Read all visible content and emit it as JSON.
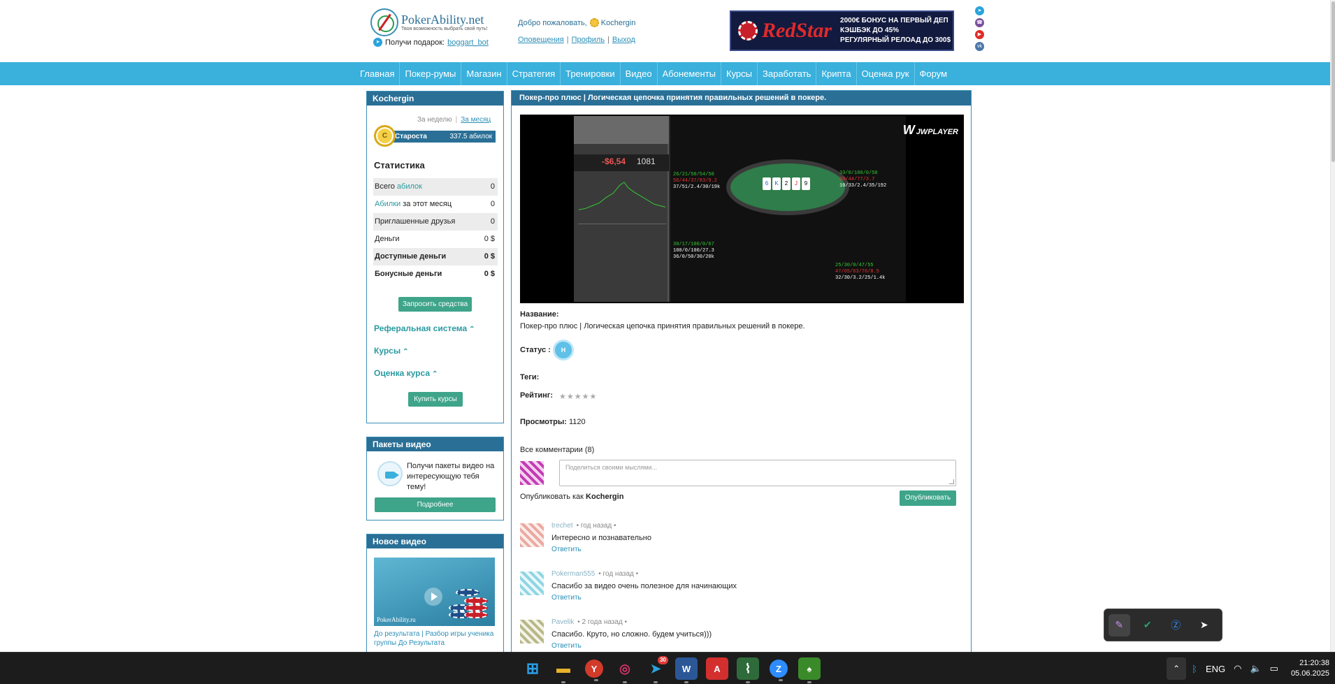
{
  "header": {
    "logo": {
      "name": "PokerAbility.net",
      "tagline": "Твоя возможность выбрать свой путь!"
    },
    "gift": {
      "label": "Получи подарок:",
      "link": "boggart_bot"
    },
    "welcome": {
      "text": "Добро пожаловать,",
      "username": "Kochergin"
    },
    "user_links": [
      "Оповещения",
      "Профиль",
      "Выход"
    ],
    "banner": {
      "brand": "RedStar",
      "lines": [
        "2000€ БОНУС НА ПЕРВЫЙ ДЕП",
        "КЭШБЭК ДО 45%",
        "РЕГУЛЯРНЫЙ РЕЛОАД ДО 300$"
      ]
    },
    "socials": [
      {
        "icon": "telegram-icon",
        "color": "#2aa3dc"
      },
      {
        "icon": "viber-icon",
        "color": "#7b519d"
      },
      {
        "icon": "youtube-icon",
        "color": "#e02a2a"
      },
      {
        "icon": "vk-icon",
        "color": "#4a76a8"
      }
    ]
  },
  "nav": [
    "Главная",
    "Покер-румы",
    "Магазин",
    "Стратегия",
    "Тренировки",
    "Видео",
    "Абонементы",
    "Курсы",
    "Заработать",
    "Крипта",
    "Оценка рук",
    "Форум"
  ],
  "sidebar": {
    "user_box": {
      "title": "Kochergin",
      "period": {
        "week": "За неделю",
        "month": "За месяц"
      },
      "rank": {
        "coin": "С",
        "label": "Староста",
        "value": "337.5 абилок"
      },
      "stats_title": "Статистика",
      "stats": [
        {
          "pre": "Всего ",
          "hl": "абилок",
          "post": "",
          "value": "0"
        },
        {
          "pre": "",
          "hl": "Абилки",
          "post": " за этот месяц",
          "value": "0"
        },
        {
          "pre": "Приглашенные друзья",
          "hl": "",
          "post": "",
          "value": "0"
        },
        {
          "pre": "Деньги",
          "hl": "",
          "post": "",
          "value": "0 $"
        },
        {
          "pre": "Доступные деньги",
          "hl": "",
          "post": "",
          "value": "0 $"
        },
        {
          "pre": "Бонусные деньги",
          "hl": "",
          "post": "",
          "value": "0 $"
        }
      ],
      "request_button": "Запросить средства",
      "sections": [
        "Реферальная система",
        "Курсы",
        "Оценка курса"
      ],
      "buy_button": "Купить курсы"
    },
    "packages_box": {
      "title": "Пакеты видео",
      "text": "Получи пакеты видео на интересующую тебя тему!",
      "button": "Подробнее"
    },
    "new_video_box": {
      "title": "Новое видео",
      "watermark": "PokerAbility.ru",
      "caption_a": "До результата",
      "caption_b": "Разбор игры ученика группы До Результата"
    }
  },
  "main": {
    "title": "Покер-про плюс | Логическая цепочка принятия правильных решений в покере.",
    "player": {
      "brand": "JWPLAYER",
      "stats": {
        "loss": "-$6,54",
        "hands": "1081"
      },
      "cards": [
        "6",
        "K",
        "2",
        "J",
        "9"
      ]
    },
    "name_label": "Название:",
    "name_value": "Покер-про плюс |  Логическая цепочка принятия правильных решений в покере.",
    "status_label": "Статус :",
    "status_badge": "Н",
    "tags_label": "Теги:",
    "rating_label": "Рейтинг:",
    "rating_stars": "★★★★★",
    "views_label": "Просмотры:",
    "views_value": "1120",
    "comments_title": "Все комментарии (8)",
    "comment_placeholder": "Поделиться своими мыслями...",
    "publish_as": "Опубликовать как",
    "publish_user": "Kochergin",
    "publish_button": "Опубликовать",
    "comments": [
      {
        "author": "trechet",
        "time": "• год назад •",
        "text": "Интересно и познавательно",
        "reply": "Ответить"
      },
      {
        "author": "Pokerman555",
        "time": "• год назад •",
        "text": "Спасибо за видео очень полезное для начинающих",
        "reply": "Ответить"
      },
      {
        "author": "Pavelik",
        "time": "• 2 года назад •",
        "text": "Спасибо. Круто, но сложно. будем учиться)))",
        "reply": "Ответить"
      }
    ]
  },
  "floating_toolbar": [
    {
      "icon": "feather-icon",
      "color": "#c48de8"
    },
    {
      "icon": "shield-check-icon",
      "color": "#2aa36a"
    },
    {
      "icon": "zoom-icon",
      "color": "#2d8cff"
    },
    {
      "icon": "send-icon",
      "color": "#ffffff"
    }
  ],
  "taskbar": {
    "apps": [
      {
        "icon": "windows-start-icon",
        "glyph": "⊞",
        "color": "#2a9fe8"
      },
      {
        "icon": "file-explorer-icon",
        "glyph": "▬",
        "color": "#e8b12a"
      },
      {
        "icon": "yandex-browser-icon",
        "glyph": "Y",
        "color": "#ffffff"
      },
      {
        "icon": "instagram-icon",
        "glyph": "◎",
        "color": "#d6336c"
      },
      {
        "icon": "telegram-icon",
        "glyph": "➤",
        "color": "#2aa3dc",
        "badge": "30"
      },
      {
        "icon": "word-icon",
        "glyph": "W",
        "color": "#2b5797"
      },
      {
        "icon": "acrobat-icon",
        "glyph": "A",
        "color": "#d32f2f"
      },
      {
        "icon": "poker-tracker-icon",
        "glyph": "⌇",
        "color": "#2f6b3a"
      },
      {
        "icon": "zoom-icon",
        "glyph": "Z",
        "color": "#2d8cff"
      },
      {
        "icon": "poker-client-icon",
        "glyph": "♠",
        "color": "#3a8a2a"
      }
    ],
    "tray": {
      "language": "ENG",
      "time": "21:20:38",
      "date": "05.06.2025"
    }
  }
}
